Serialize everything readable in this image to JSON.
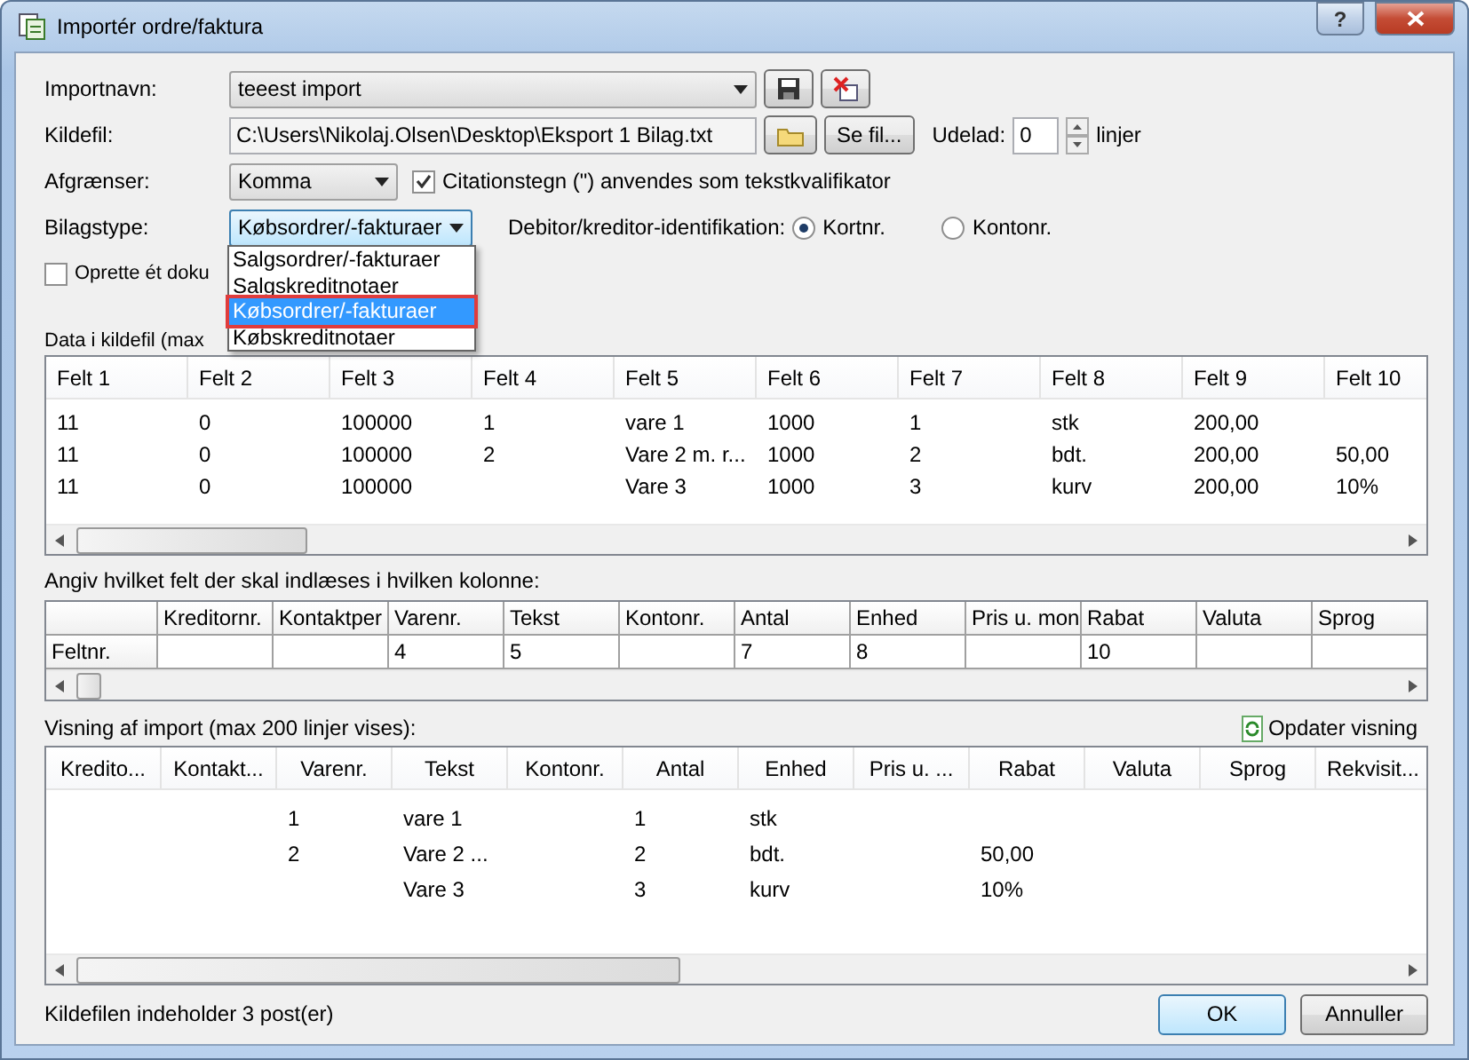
{
  "window": {
    "title": "Importér ordre/faktura",
    "buttons": [
      "?"
    ]
  },
  "import_name": {
    "label": "Importnavn:",
    "value": "teeest import"
  },
  "source_file": {
    "label": "Kildefil:",
    "value": "C:\\Users\\Nikolaj.Olsen\\Desktop\\Eksport 1 Bilag.txt",
    "browse": "Se fil...",
    "skip_label": "Udelad:",
    "skip_value": "0",
    "skip_suffix": "linjer"
  },
  "delimiter": {
    "label": "Afgrænser:",
    "value": "Komma"
  },
  "qualifier": {
    "label": "Citationstegn (\") anvendes som tekstkvalifikator",
    "checked": true
  },
  "voucher_type": {
    "label": "Bilagstype:",
    "value": "Købsordrer/-fakturaer",
    "expanded": true,
    "options": [
      {
        "label": "Salgsordrer/-fakturaer",
        "selected": false
      },
      {
        "label": "Salgskreditnotaer",
        "selected": false
      },
      {
        "label": "Købsordrer/-fakturaer",
        "selected": true
      },
      {
        "label": "Købskreditnotaer",
        "selected": false
      }
    ]
  },
  "identification": {
    "label": "Debitor/kreditor-identifikation:",
    "options": [
      {
        "label": "Kortnr.",
        "selected": true
      },
      {
        "label": "Kontonr.",
        "selected": false
      }
    ]
  },
  "single_document": {
    "label": "Oprette ét doku",
    "checked": false
  },
  "source_data": {
    "label": "Data i kildefil (max",
    "columns": [
      "Felt 1",
      "Felt 2",
      "Felt 3",
      "Felt 4",
      "Felt 5",
      "Felt 6",
      "Felt 7",
      "Felt 8",
      "Felt 9",
      "Felt 10"
    ],
    "rows": [
      [
        "11",
        "0",
        "100000",
        "1",
        "vare 1",
        "1000",
        "1",
        "stk",
        "200,00",
        null
      ],
      [
        "11",
        "0",
        "100000",
        "2",
        "Vare 2 m. r...",
        "1000",
        "2",
        "bdt.",
        "200,00",
        "50,00"
      ],
      [
        "11",
        "0",
        "100000",
        null,
        "Vare 3",
        "1000",
        "3",
        "kurv",
        "200,00",
        "10%"
      ]
    ]
  },
  "mapping": {
    "label": "Angiv hvilket felt der skal indlæses i hvilken kolonne:",
    "row_header": "Feltnr.",
    "columns": [
      {
        "name": "Kreditornr."
      },
      {
        "name": "Kontaktper"
      },
      {
        "name": "Varenr.",
        "field": "4"
      },
      {
        "name": "Tekst",
        "field": "5"
      },
      {
        "name": "Kontonr."
      },
      {
        "name": "Antal",
        "field": "7"
      },
      {
        "name": "Enhed",
        "field": "8"
      },
      {
        "name": "Pris u. mon"
      },
      {
        "name": "Rabat",
        "field": "10"
      },
      {
        "name": "Valuta"
      },
      {
        "name": "Sprog"
      }
    ]
  },
  "preview": {
    "label": "Visning af import (max 200 linjer vises):",
    "refresh": "Opdater visning",
    "columns": [
      "Kredito...",
      "Kontakt...",
      "Varenr.",
      "Tekst",
      "Kontonr.",
      "Antal",
      "Enhed",
      "Pris u. ...",
      "Rabat",
      "Valuta",
      "Sprog",
      "Rekvisit..."
    ],
    "rows": [
      [
        null,
        null,
        "1",
        "vare 1",
        null,
        "1",
        "stk",
        null,
        null,
        null,
        null,
        null
      ],
      [
        null,
        null,
        "2",
        "Vare 2 ...",
        null,
        "2",
        "bdt.",
        null,
        "50,00",
        null,
        null,
        null
      ],
      [
        null,
        null,
        null,
        "Vare 3",
        null,
        "3",
        "kurv",
        null,
        "10%",
        null,
        null,
        null
      ]
    ]
  },
  "status": "Kildefilen indeholder 3 post(er)",
  "buttons": [
    {
      "label": "OK",
      "default": true
    },
    {
      "label": "Annuller",
      "default": false
    }
  ]
}
